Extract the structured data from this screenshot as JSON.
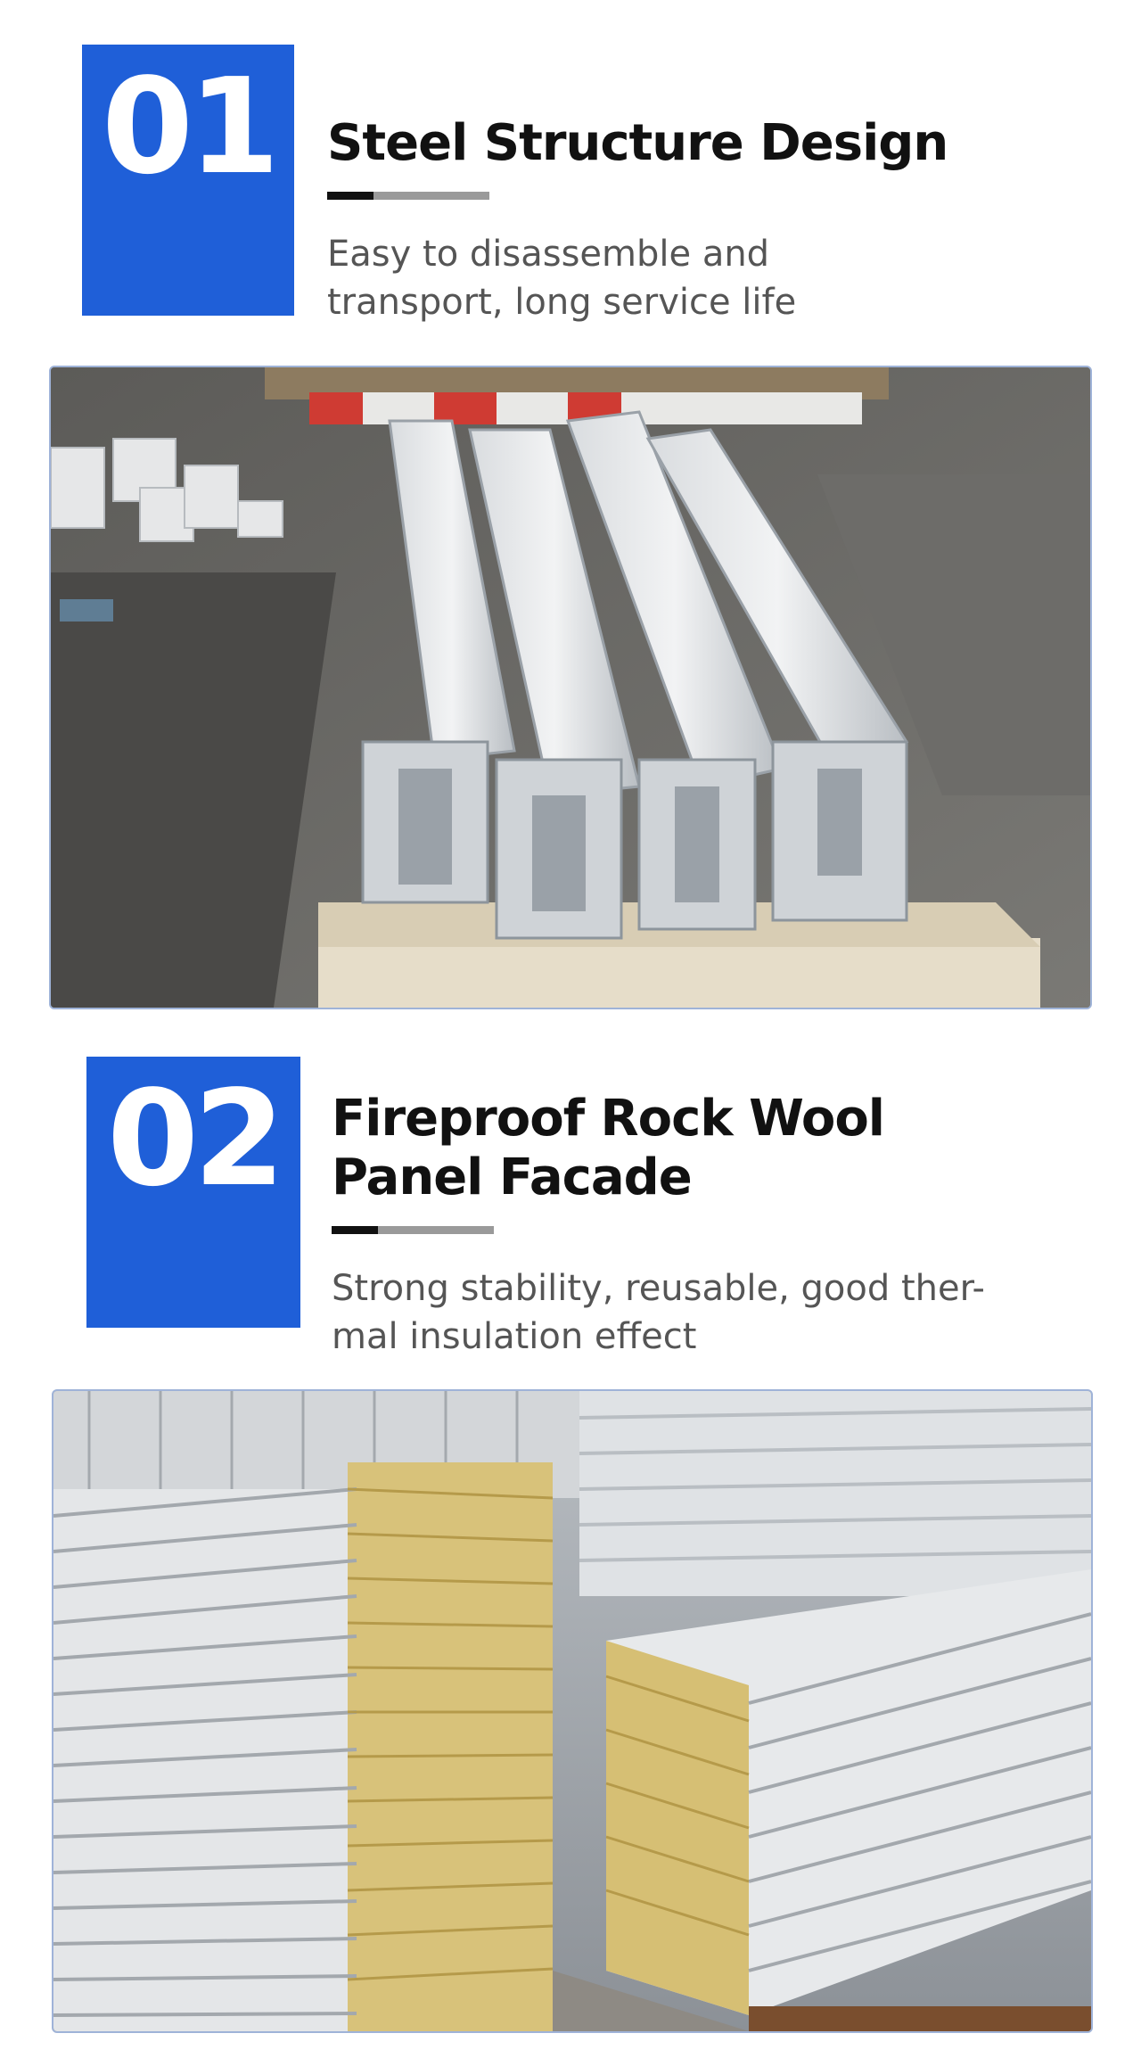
{
  "features": [
    {
      "number": "01",
      "title": "Steel Structure Design",
      "description_lines": [
        "Easy to disassemble and",
        "transport, long service life"
      ],
      "image": "steel-beams-photo"
    },
    {
      "number": "02",
      "title_lines": [
        "Fireproof Rock Wool",
        "Panel Facade"
      ],
      "description_lines": [
        "Strong stability, reusable, good ther-",
        "mal insulation effect"
      ],
      "image": "rock-wool-panels-photo"
    }
  ],
  "colors": {
    "accent": "#1f5fd8",
    "title": "#111111",
    "description": "#555555",
    "rule": "#9a9a9a"
  }
}
